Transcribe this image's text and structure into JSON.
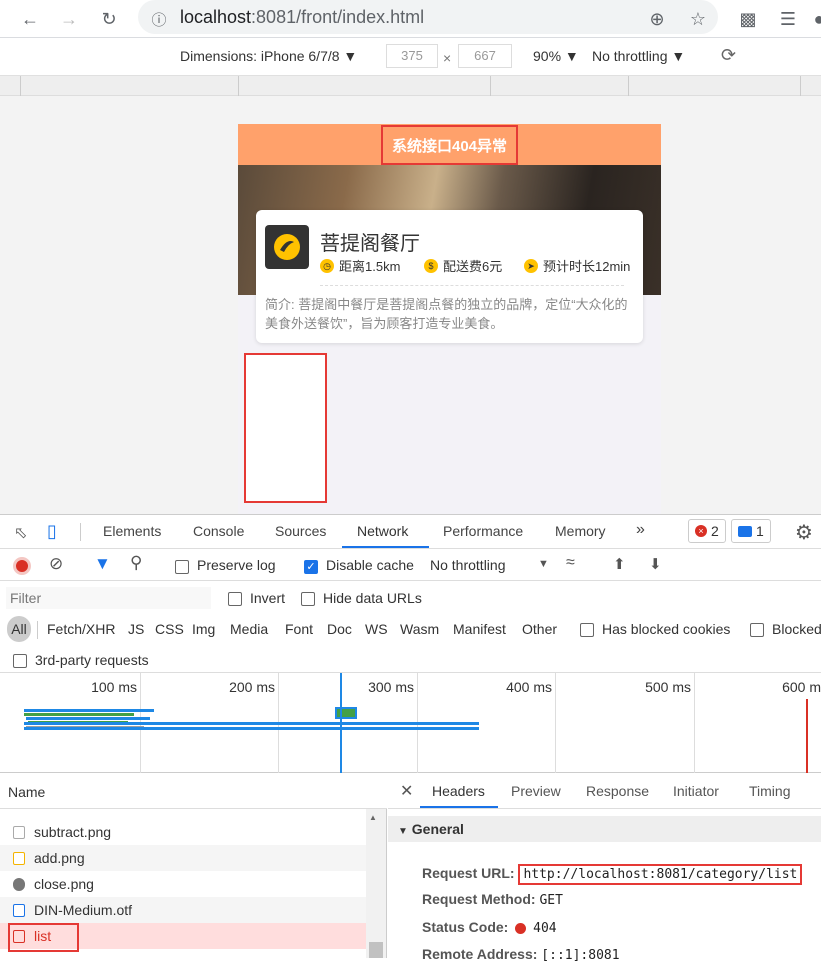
{
  "browser": {
    "url_host": "localhost",
    "url_rest": ":8081/front/index.html",
    "back_icon": "back-arrow-icon",
    "forward_icon": "forward-arrow-icon",
    "reload_icon": "reload-icon"
  },
  "device_bar": {
    "dimensions": "Dimensions: iPhone 6/7/8 ▼",
    "width": "375",
    "times": "×",
    "height": "667",
    "zoom": "90% ▼",
    "throttling": "No throttling ▼"
  },
  "app": {
    "header_title": "系统接口404异常",
    "shop_name": "菩提阁餐厅",
    "distance": "距离1.5km",
    "delivery_fee": "配送费6元",
    "eta": "预计时长12min",
    "description": "简介: 菩提阁中餐厅是菩提阁点餐的独立的品牌，定位“大众化的美食外送餐饮”，旨为顾客打造专业美食。"
  },
  "devtools": {
    "tabs": [
      "Elements",
      "Console",
      "Sources",
      "Network",
      "Performance",
      "Memory",
      "»"
    ],
    "error_count": "2",
    "message_count": "1",
    "preserve_log": "Preserve log",
    "disable_cache": "Disable cache",
    "throttling": "No throttling",
    "filter_placeholder": "Filter",
    "invert": "Invert",
    "hide_data_urls": "Hide data URLs",
    "types": [
      "All",
      "Fetch/XHR",
      "JS",
      "CSS",
      "Img",
      "Media",
      "Font",
      "Doc",
      "WS",
      "Wasm",
      "Manifest",
      "Other"
    ],
    "has_blocked_cookies": "Has blocked cookies",
    "blocked": "Blocked",
    "third_party": "3rd-party requests",
    "ticks": [
      "100 ms",
      "200 ms",
      "300 ms",
      "400 ms",
      "500 ms",
      "600 m"
    ],
    "name_header": "Name",
    "requests": [
      "subtract.png",
      "add.png",
      "close.png",
      "DIN-Medium.otf",
      "list"
    ],
    "detail_tabs": [
      "Headers",
      "Preview",
      "Response",
      "Initiator",
      "Timing"
    ],
    "general": "General",
    "request_url_key": "Request URL:",
    "request_url": "http://localhost:8081/category/list",
    "request_method_key": "Request Method:",
    "request_method": "GET",
    "status_code_key": "Status Code:",
    "status_code": "404",
    "remote_address_key": "Remote Address:",
    "remote_address": "[::1]:8081"
  }
}
